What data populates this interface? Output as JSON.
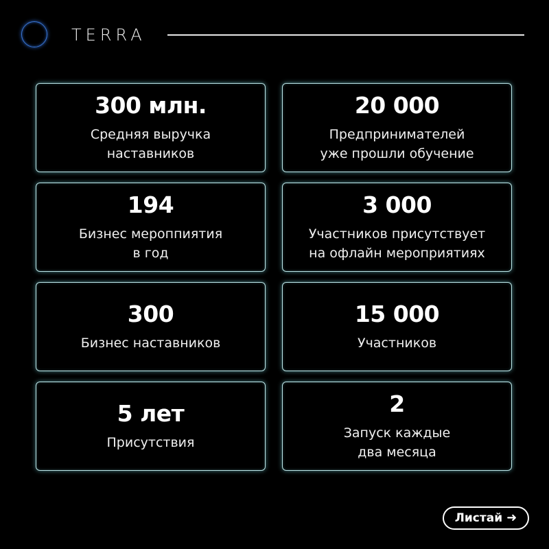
{
  "header": {
    "brand": "TERRA"
  },
  "stats": [
    {
      "value": "300 млн.",
      "label": "Средняя выручка\nнаставников"
    },
    {
      "value": "20 000",
      "label": "Предпринимателей\nуже прошли обучение"
    },
    {
      "value": "194",
      "label": "Бизнес мероппиятия\nв год"
    },
    {
      "value": "3 000",
      "label": "Участников присутствует\nна офлайн мероприятиях"
    },
    {
      "value": "300",
      "label": "Бизнес наставников"
    },
    {
      "value": "15 000",
      "label": "Участников"
    },
    {
      "value": "5 лет",
      "label": "Присутствия"
    },
    {
      "value": "2",
      "label": "Запуск каждые\nдва месяца"
    }
  ],
  "footer": {
    "next_label": "Листай",
    "next_icon": "arrow-right-icon"
  },
  "colors": {
    "background": "#000000",
    "card_border": "#bfe8ea",
    "logo_ring": "#3b78d8"
  }
}
